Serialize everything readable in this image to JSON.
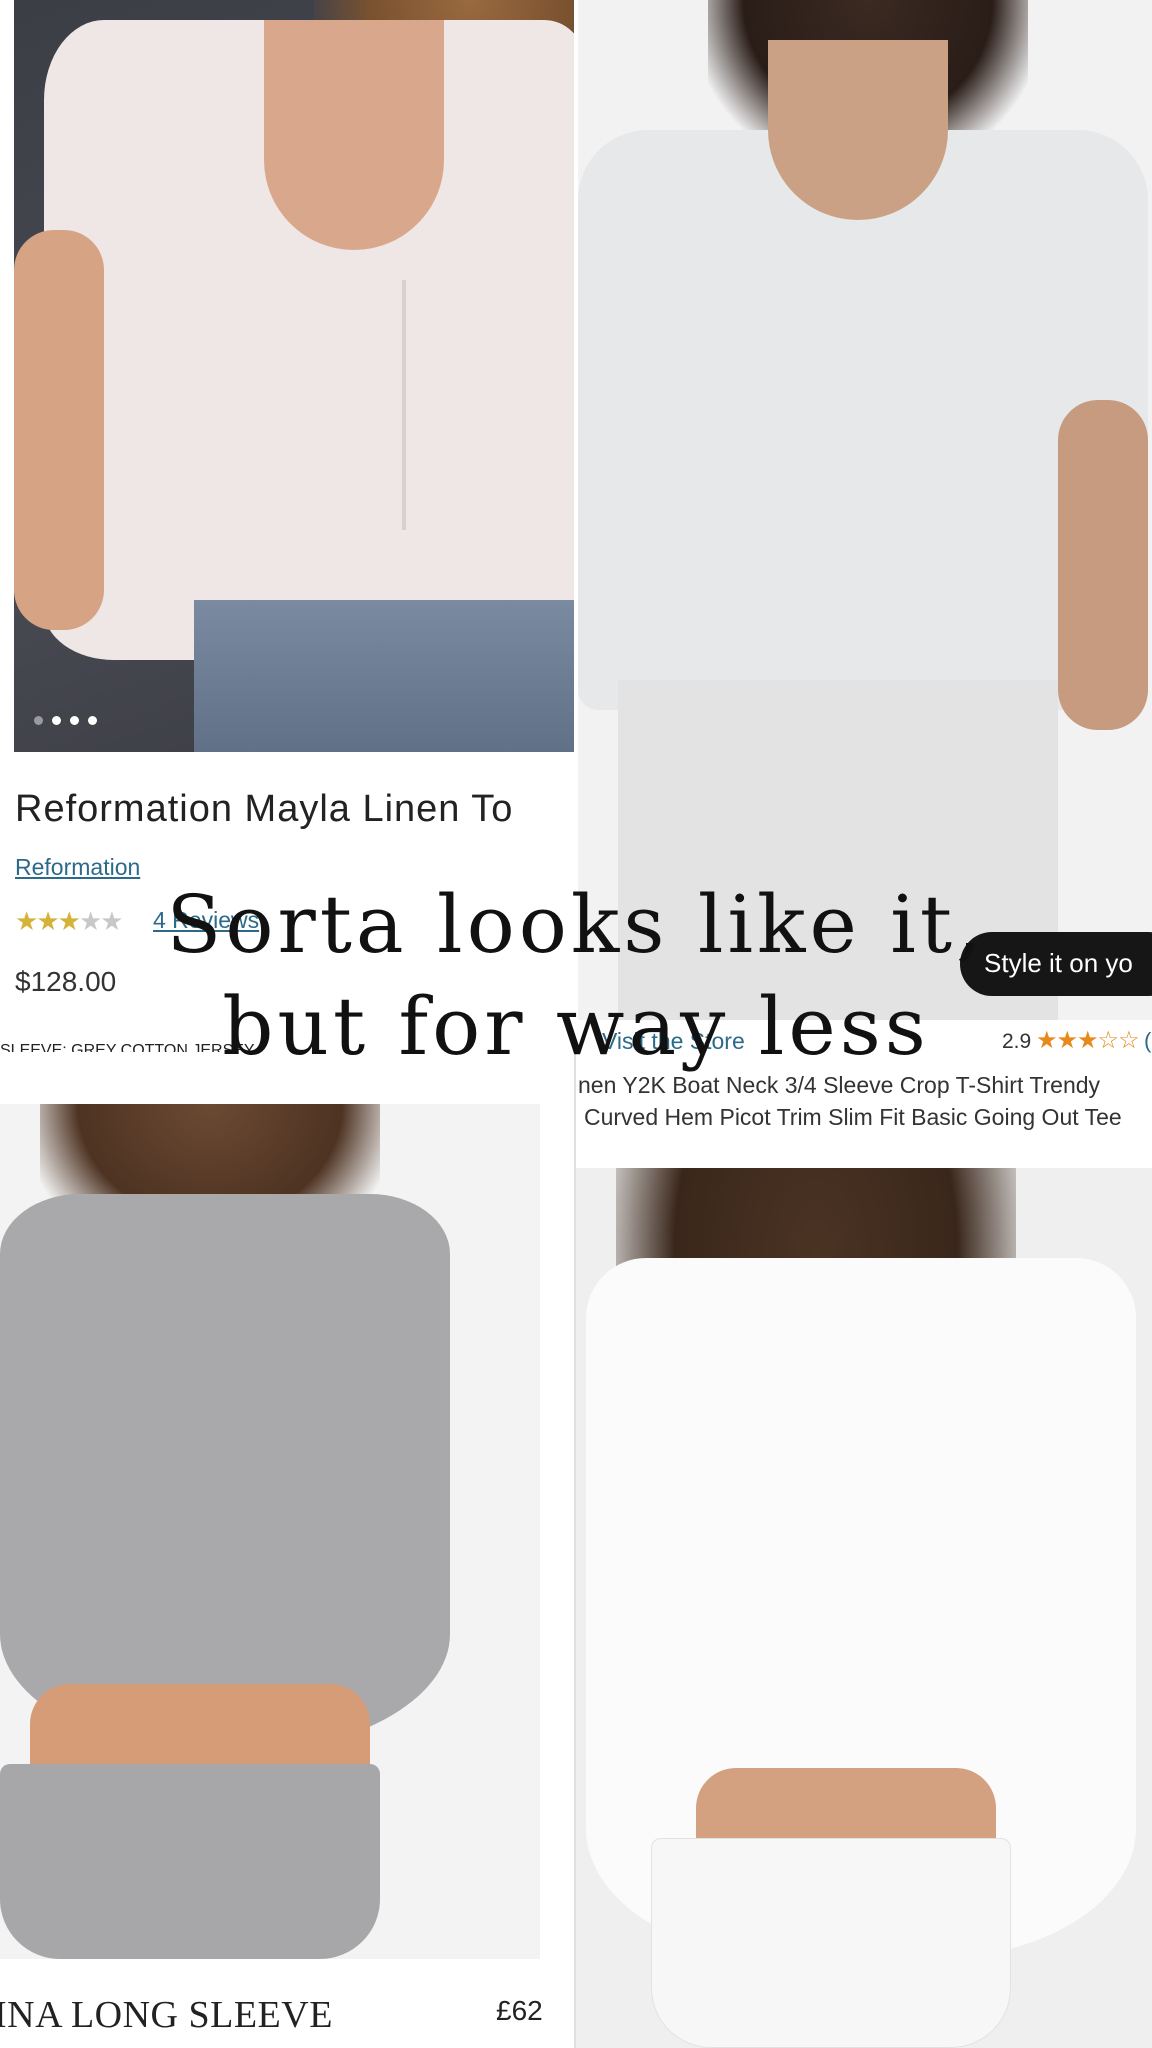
{
  "headline": {
    "line1": "Sorta looks like it,",
    "line2": "but for way less"
  },
  "reformation_listing": {
    "product_title": "Reformation Mayla Linen To",
    "brand": "Reformation",
    "rating_stars": "★★★★★",
    "rating_value": 2.5,
    "reviews": "4 Reviews",
    "price": "$128.00",
    "carousel_count": 4,
    "carousel_active": 1
  },
  "sleeve_caption": "SLEEVE: GREY COTTON JERSEY",
  "amazon_listing": {
    "style_button": "Style it on yo",
    "store_link": "Visit the Store",
    "rating": "2.9",
    "rating_stars": "★★★☆☆",
    "rating_paren": "(",
    "title_line1": "nen Y2K Boat Neck 3/4 Sleeve Crop T-Shirt Trendy",
    "title_line2": "Curved Hem Picot Trim Slim Fit Basic Going Out Tee"
  },
  "grey_listing": {
    "name": "INA LONG SLEEVE",
    "price": "£62"
  },
  "colors": {
    "link_blue": "#2b6a8a",
    "amazon_star": "#e8891c",
    "reformation_star": "#d4b33a",
    "button_black": "#161616"
  }
}
